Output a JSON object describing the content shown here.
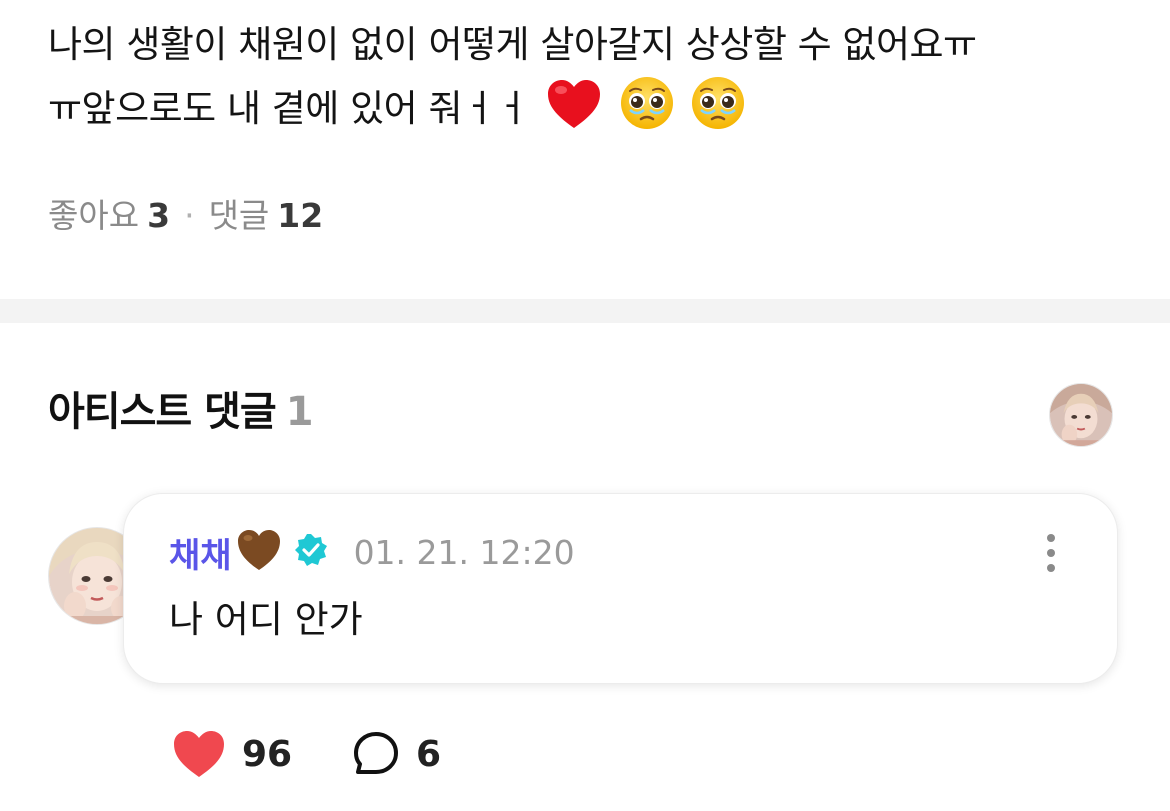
{
  "post": {
    "line1": "나의 생활이 채원이 없이 어떻게 살아갈지 상상할 수 없어요ㅠ",
    "line2": "ㅠ앞으로도 내 곁에 있어 줘ㅓㅓ",
    "emojis": [
      "red-heart-icon",
      "pleading-face-icon",
      "pleading-face-icon"
    ]
  },
  "stats": {
    "likes_label": "좋아요",
    "likes_count": "3",
    "separator": "·",
    "comments_label": "댓글",
    "comments_count": "12"
  },
  "artist_comments": {
    "title": "아티스트 댓글",
    "count": "1"
  },
  "comment": {
    "author": "채채",
    "author_emoji": "brown-heart-icon",
    "badge": "verified-icon",
    "timestamp": "01. 21. 12:20",
    "text": "나 어디 안가",
    "like_count": "96",
    "reply_count": "6"
  },
  "colors": {
    "author_name": "#5a55e8",
    "like_heart": "#f0484f",
    "verified_badge": "#1fc8d4",
    "divider": "#f3f3f3",
    "muted_text": "#9a9a9a"
  }
}
